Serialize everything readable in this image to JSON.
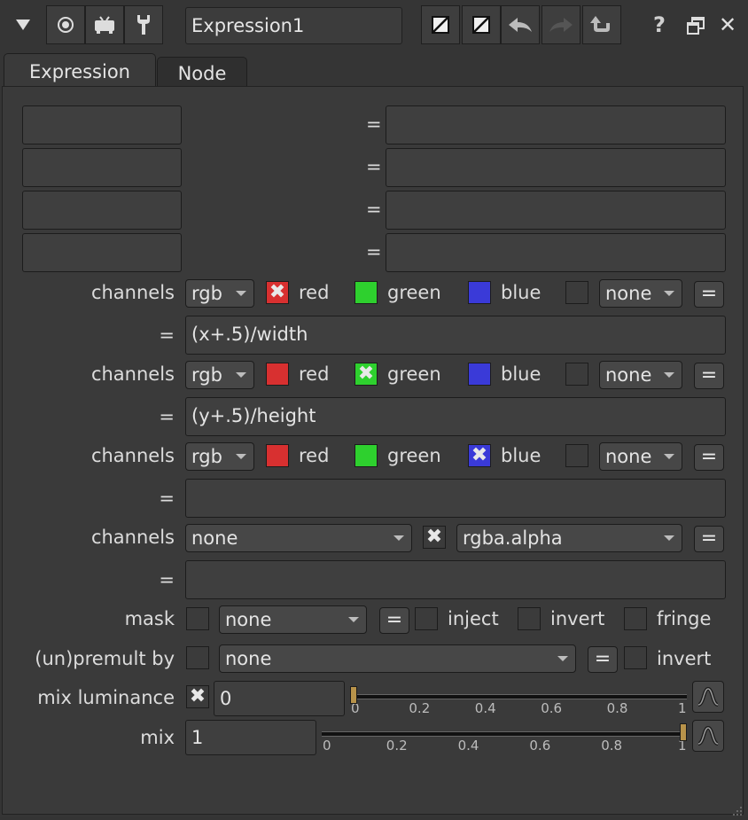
{
  "toolbar": {
    "node_name": "Expression1",
    "buttons": [
      "collapse-icon",
      "viewer-icon",
      "monitor-icon",
      "wrench-icon",
      "input-toggle-icon",
      "output-toggle-icon",
      "undo-icon",
      "redo-icon",
      "revert-icon",
      "help-icon",
      "float-icon",
      "close-icon"
    ],
    "help_label": "?",
    "close_label": "✕"
  },
  "tabs": [
    {
      "label": "Expression",
      "active": true
    },
    {
      "label": "Node",
      "active": false
    }
  ],
  "temps": {
    "eq": "=",
    "rows": [
      {
        "name": "",
        "value": ""
      },
      {
        "name": "",
        "value": ""
      },
      {
        "name": "",
        "value": ""
      },
      {
        "name": "",
        "value": ""
      }
    ]
  },
  "channels_label": "channels",
  "eq_label": "=",
  "channel_rows": [
    {
      "layer": "rgb",
      "red": {
        "label": "red",
        "checked": true,
        "color": "#d83030"
      },
      "green": {
        "label": "green",
        "checked": false,
        "color": "#2ed02e"
      },
      "blue": {
        "label": "blue",
        "checked": false,
        "color": "#3a3ad8"
      },
      "extra_checked": false,
      "extra_layer": "none",
      "expression": "(x+.5)/width"
    },
    {
      "layer": "rgb",
      "red": {
        "label": "red",
        "checked": false,
        "color": "#d83030"
      },
      "green": {
        "label": "green",
        "checked": true,
        "color": "#2ed02e"
      },
      "blue": {
        "label": "blue",
        "checked": false,
        "color": "#3a3ad8"
      },
      "extra_checked": false,
      "extra_layer": "none",
      "expression": "(y+.5)/height"
    },
    {
      "layer": "rgb",
      "red": {
        "label": "red",
        "checked": false,
        "color": "#d83030"
      },
      "green": {
        "label": "green",
        "checked": false,
        "color": "#2ed02e"
      },
      "blue": {
        "label": "blue",
        "checked": true,
        "color": "#3a3ad8"
      },
      "extra_checked": false,
      "extra_layer": "none",
      "expression": ""
    }
  ],
  "alpha_row": {
    "layer": "none",
    "checked": true,
    "channel": "rgba.alpha",
    "expression": ""
  },
  "mask": {
    "label": "mask",
    "checked": false,
    "value": "none",
    "inject_label": "inject",
    "inject_checked": false,
    "invert_label": "invert",
    "invert_checked": false,
    "fringe_label": "fringe",
    "fringe_checked": false
  },
  "premult": {
    "label": "(un)premult by",
    "checked": false,
    "value": "none",
    "invert_label": "invert",
    "invert_checked": false
  },
  "mix_luminance": {
    "label": "mix luminance",
    "checked": true,
    "value": "0",
    "ticks": [
      "0",
      "0.2",
      "0.4",
      "0.6",
      "0.8",
      "1"
    ],
    "level": 0
  },
  "mix": {
    "label": "mix",
    "value": "1",
    "ticks": [
      "0",
      "0.2",
      "0.4",
      "0.6",
      "0.8",
      "1"
    ],
    "level": 1
  },
  "colors": {
    "panel_bg": "#353535",
    "handle": "#b8934a"
  }
}
